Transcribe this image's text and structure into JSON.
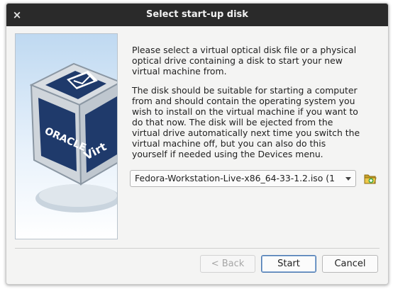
{
  "window": {
    "title": "Select start-up disk"
  },
  "close": {
    "glyph": "×"
  },
  "body": {
    "paragraph1": "Please select a virtual optical disk file or a physical\noptical drive containing a disk to start your new\nvirtual machine from.",
    "paragraph2": "The disk should be suitable for starting a computer\nfrom and should contain the operating system you\nwish to install on the virtual machine if you want to\ndo that now. The disk will be ejected from the\nvirtual drive automatically next time you switch the\nvirtual machine off, but you can also do this\nyourself if needed using the Devices menu."
  },
  "disk_select": {
    "selected": "Fedora-Workstation-Live-x86_64-33-1.2.iso (1"
  },
  "banner": {
    "logo_text_1": "ORACLE",
    "logo_text_2": "Virt"
  },
  "buttons": {
    "back": "< Back",
    "start": "Start",
    "cancel": "Cancel"
  },
  "colors": {
    "titlebar": "#2a2a2a",
    "dialog_bg": "#f4f4f3",
    "default_button_border": "#4a78b0",
    "cube_blue": "#1f3a6b"
  },
  "icons": {
    "close": "close-icon",
    "folder": "folder-open-icon",
    "dropdown": "chevron-down-icon"
  }
}
